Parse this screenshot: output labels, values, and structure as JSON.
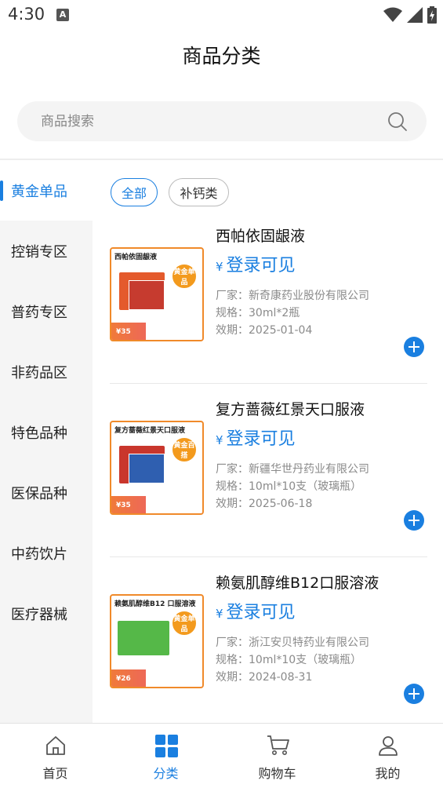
{
  "status_bar": {
    "time": "4:30"
  },
  "header": {
    "title": "商品分类"
  },
  "search": {
    "placeholder": "商品搜索"
  },
  "sidebar": {
    "items": [
      {
        "label": "黄金单品",
        "active": true
      },
      {
        "label": "控销专区"
      },
      {
        "label": "普药专区"
      },
      {
        "label": "非药品区"
      },
      {
        "label": "特色品种"
      },
      {
        "label": "医保品种"
      },
      {
        "label": "中药饮片"
      },
      {
        "label": "医疗器械"
      }
    ]
  },
  "filters": {
    "all": "全部",
    "calcium": "补钙类"
  },
  "price_currency": "¥",
  "products": [
    {
      "name": "西帕依固龈液",
      "price": "登录可见",
      "manufacturer": "厂家：新奇康药业股份有限公司",
      "spec": "规格：30ml*2瓶",
      "expiry": "效期：2025-01-04",
      "image": {
        "title": "西帕依固龈液",
        "badge": "黄金单品",
        "price": "¥35"
      }
    },
    {
      "name": "复方蔷薇红景天口服液",
      "price": "登录可见",
      "manufacturer": "厂家：新疆华世丹药业有限公司",
      "spec": "规格：10ml*10支（玻璃瓶）",
      "expiry": "效期：2025-06-18",
      "image": {
        "title": "复方蔷薇红景天口服液",
        "badge": "黄金百搭",
        "price": "¥35"
      }
    },
    {
      "name": "赖氨肌醇维B12口服溶液",
      "price": "登录可见",
      "manufacturer": "厂家：浙江安贝特药业有限公司",
      "spec": "规格：10ml*10支（玻璃瓶）",
      "expiry": "效期：2024-08-31",
      "image": {
        "title": "赖氨肌醇维B12 口服溶液",
        "badge": "黄金单品",
        "price": "¥26"
      }
    }
  ],
  "tab_bar": {
    "home": "首页",
    "category": "分类",
    "cart": "购物车",
    "mine": "我的"
  },
  "colors": {
    "accent": "#1a7fe0",
    "badge": "#f39a1d"
  }
}
